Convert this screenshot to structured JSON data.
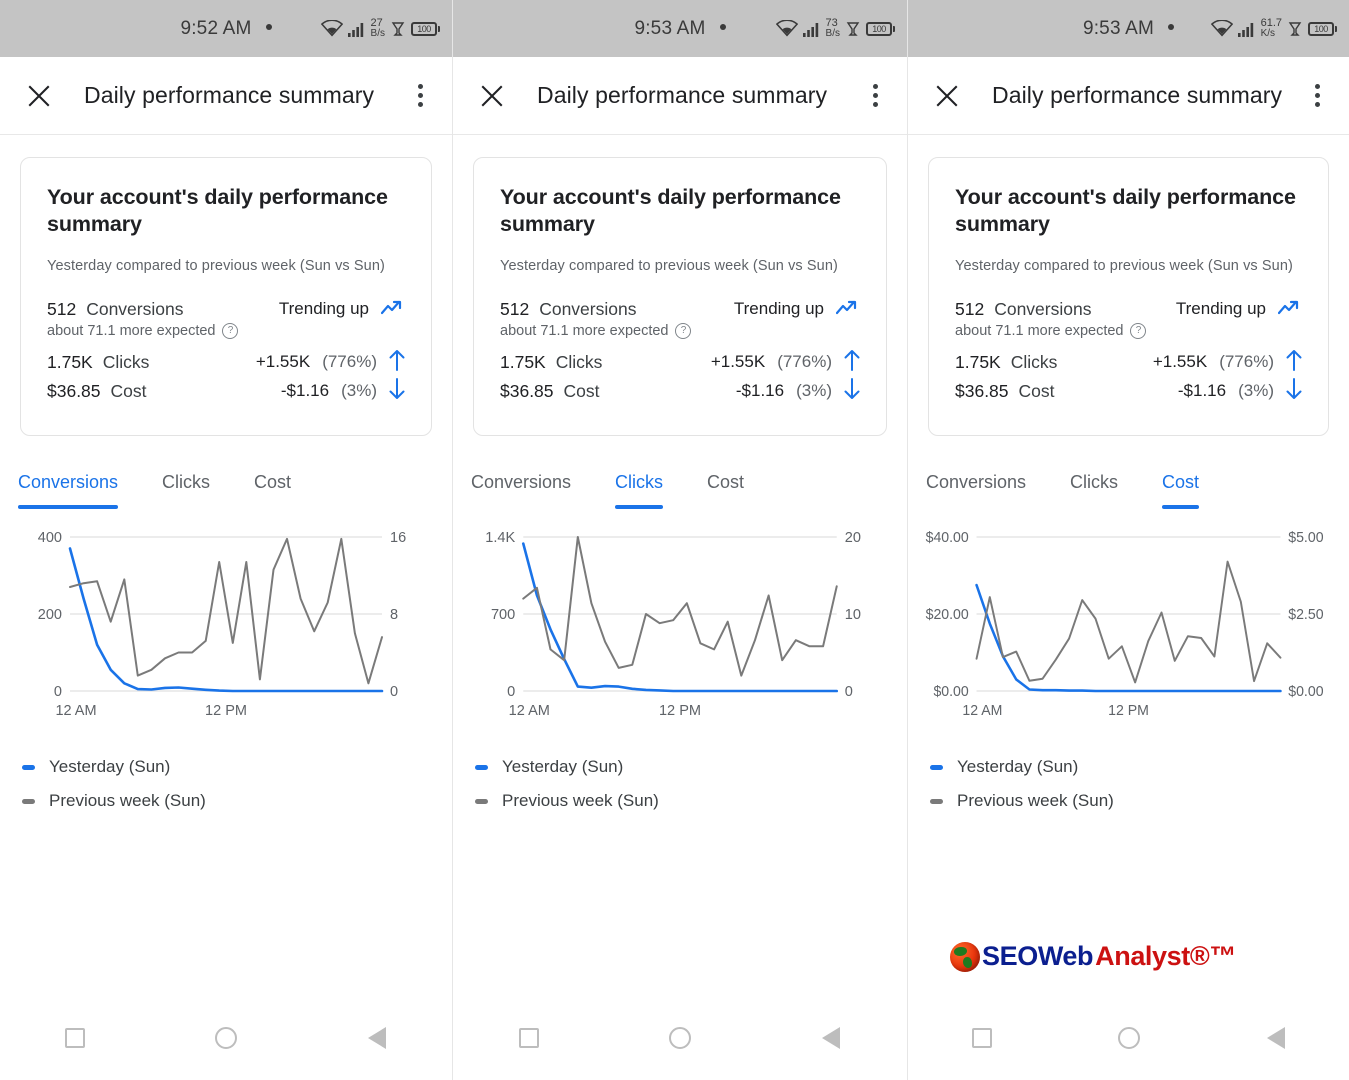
{
  "colors": {
    "accent": "#1a73e8",
    "previous_week_line": "#7a7a7a",
    "status_bar_bg": "#c4c4c4",
    "text_primary": "#202124",
    "text_secondary": "#5f6368"
  },
  "panels": [
    {
      "status_bar": {
        "time": "9:52 AM",
        "net_rate_value": "27",
        "net_rate_unit": "B/s",
        "battery_level": "100",
        "wifi_icon": "wifi-icon",
        "signal_icon": "cell-signal-icon",
        "alarm_icon": "alarm-icon",
        "battery_icon": "battery-icon"
      },
      "app_bar": {
        "close_label": "✕",
        "title": "Daily performance summary",
        "menu_label": "more-options"
      },
      "card": {
        "title": "Your account's daily performance summary",
        "subtitle": "Yesterday compared to previous week (Sun vs Sun)",
        "rows": [
          {
            "value": "512",
            "label": "Conversions",
            "delta": "Trending up",
            "pct": "",
            "arrow": "trending-up"
          },
          {
            "value": "1.75K",
            "label": "Clicks",
            "delta": "+1.55K",
            "pct": "(776%)",
            "arrow": "up"
          },
          {
            "value": "$36.85",
            "label": "Cost",
            "delta": "-$1.16",
            "pct": "(3%)",
            "arrow": "down"
          }
        ],
        "note": "about 71.1 more expected",
        "note_icon": "help-icon"
      },
      "tabs": [
        {
          "label": "Conversions",
          "active": true
        },
        {
          "label": "Clicks",
          "active": false
        },
        {
          "label": "Cost",
          "active": false
        }
      ],
      "legend": [
        {
          "label": "Yesterday (Sun)",
          "color": "#1a73e8"
        },
        {
          "label": "Previous week (Sun)",
          "color": "#7a7a7a"
        }
      ]
    },
    {
      "status_bar": {
        "time": "9:53 AM",
        "net_rate_value": "73",
        "net_rate_unit": "B/s",
        "battery_level": "100"
      },
      "app_bar": {
        "close_label": "✕",
        "title": "Daily performance summary"
      },
      "card": {
        "title": "Your account's daily performance summary",
        "subtitle": "Yesterday compared to previous week (Sun vs Sun)",
        "rows": [
          {
            "value": "512",
            "label": "Conversions",
            "delta": "Trending up",
            "pct": "",
            "arrow": "trending-up"
          },
          {
            "value": "1.75K",
            "label": "Clicks",
            "delta": "+1.55K",
            "pct": "(776%)",
            "arrow": "up"
          },
          {
            "value": "$36.85",
            "label": "Cost",
            "delta": "-$1.16",
            "pct": "(3%)",
            "arrow": "down"
          }
        ],
        "note": "about 71.1 more expected"
      },
      "tabs": [
        {
          "label": "Conversions",
          "active": false
        },
        {
          "label": "Clicks",
          "active": true
        },
        {
          "label": "Cost",
          "active": false
        }
      ],
      "legend": [
        {
          "label": "Yesterday (Sun)",
          "color": "#1a73e8"
        },
        {
          "label": "Previous week (Sun)",
          "color": "#7a7a7a"
        }
      ]
    },
    {
      "status_bar": {
        "time": "9:53 AM",
        "net_rate_value": "61.7",
        "net_rate_unit": "K/s",
        "battery_level": "100"
      },
      "app_bar": {
        "close_label": "✕",
        "title": "Daily performance summary"
      },
      "card": {
        "title": "Your account's daily performance summary",
        "subtitle": "Yesterday compared to previous week (Sun vs Sun)",
        "rows": [
          {
            "value": "512",
            "label": "Conversions",
            "delta": "Trending up",
            "pct": "",
            "arrow": "trending-up"
          },
          {
            "value": "1.75K",
            "label": "Clicks",
            "delta": "+1.55K",
            "pct": "(776%)",
            "arrow": "up"
          },
          {
            "value": "$36.85",
            "label": "Cost",
            "delta": "-$1.16",
            "pct": "(3%)",
            "arrow": "down"
          }
        ],
        "note": "about 71.1 more expected"
      },
      "tabs": [
        {
          "label": "Conversions",
          "active": false
        },
        {
          "label": "Clicks",
          "active": false
        },
        {
          "label": "Cost",
          "active": true
        }
      ],
      "legend": [
        {
          "label": "Yesterday (Sun)",
          "color": "#1a73e8"
        },
        {
          "label": "Previous week (Sun)",
          "color": "#7a7a7a"
        }
      ]
    }
  ],
  "watermark": {
    "seo": "SEOWeb",
    "analyst": "Analyst®™",
    "icon": "globe-icon"
  },
  "navbar": {
    "recents": "recents-button",
    "home": "home-button",
    "back": "back-button"
  },
  "chart_data": [
    {
      "type": "line",
      "title": "Conversions",
      "xlabel": "",
      "ylabel": "Conversions",
      "x_ticks": [
        "12 AM",
        "12 PM"
      ],
      "left_axis": {
        "ticks": [
          "0",
          "200",
          "400"
        ],
        "ylim": [
          0,
          400
        ]
      },
      "right_axis": {
        "ticks": [
          "0",
          "8",
          "16"
        ],
        "ylim": [
          0,
          16
        ]
      },
      "grid": true,
      "legend_position": "below",
      "series": [
        {
          "name": "Yesterday (Sun)",
          "axis": "left",
          "color": "#1a73e8",
          "values": [
            370,
            240,
            120,
            55,
            20,
            5,
            4,
            8,
            9,
            6,
            3,
            1,
            0,
            0,
            0,
            0,
            0,
            0,
            0,
            0,
            0,
            0,
            0,
            0
          ]
        },
        {
          "name": "Previous week (Sun)",
          "axis": "right",
          "color": "#7a7a7a",
          "values": [
            10.8,
            11.2,
            11.4,
            7.2,
            11.6,
            1.6,
            2.2,
            3.4,
            4.0,
            4.0,
            5.2,
            13.4,
            5.0,
            13.4,
            1.2,
            12.6,
            15.8,
            9.6,
            6.2,
            9.2,
            15.8,
            6.0,
            0.8,
            5.6
          ]
        }
      ]
    },
    {
      "type": "line",
      "title": "Clicks",
      "xlabel": "",
      "ylabel": "Clicks",
      "x_ticks": [
        "12 AM",
        "12 PM"
      ],
      "left_axis": {
        "ticks": [
          "0",
          "700",
          "1.4K"
        ],
        "ylim": [
          0,
          1400
        ]
      },
      "right_axis": {
        "ticks": [
          "0",
          "10",
          "20"
        ],
        "ylim": [
          0,
          20
        ]
      },
      "grid": true,
      "legend_position": "below",
      "series": [
        {
          "name": "Yesterday (Sun)",
          "axis": "left",
          "color": "#1a73e8",
          "values": [
            1340,
            870,
            560,
            290,
            40,
            30,
            45,
            40,
            20,
            10,
            5,
            0,
            0,
            0,
            0,
            0,
            0,
            0,
            0,
            0,
            0,
            0,
            0,
            0
          ]
        },
        {
          "name": "Previous week (Sun)",
          "axis": "right",
          "color": "#7a7a7a",
          "values": [
            12.0,
            13.4,
            5.4,
            4.0,
            20.0,
            11.4,
            6.4,
            3.0,
            3.4,
            10.0,
            8.8,
            9.2,
            11.4,
            6.2,
            5.4,
            9.0,
            2.0,
            6.6,
            12.4,
            4.0,
            6.6,
            5.8,
            5.8,
            13.6
          ]
        }
      ]
    },
    {
      "type": "line",
      "title": "Cost",
      "xlabel": "",
      "ylabel": "Cost",
      "x_ticks": [
        "12 AM",
        "12 PM"
      ],
      "left_axis": {
        "ticks": [
          "$0.00",
          "$20.00",
          "$40.00"
        ],
        "ylim": [
          0,
          40
        ]
      },
      "right_axis": {
        "ticks": [
          "$0.00",
          "$2.50",
          "$5.00"
        ],
        "ylim": [
          0,
          5
        ]
      },
      "grid": true,
      "legend_position": "below",
      "series": [
        {
          "name": "Yesterday (Sun)",
          "axis": "left",
          "color": "#1a73e8",
          "values": [
            27.5,
            17.5,
            9.0,
            3.0,
            0.4,
            0.2,
            0.2,
            0.1,
            0.1,
            0.0,
            0.0,
            0.0,
            0.0,
            0.0,
            0.0,
            0.0,
            0.0,
            0.0,
            0.0,
            0.0,
            0.0,
            0.0,
            0.0,
            0.0
          ]
        },
        {
          "name": "Previous week (Sun)",
          "axis": "right",
          "color": "#7a7a7a",
          "values": [
            1.05,
            3.05,
            1.1,
            1.28,
            0.33,
            0.4,
            1.02,
            1.7,
            2.95,
            2.35,
            1.05,
            1.45,
            0.28,
            1.62,
            2.55,
            0.98,
            1.78,
            1.72,
            1.12,
            4.2,
            2.9,
            0.32,
            1.55,
            1.08
          ]
        }
      ]
    }
  ]
}
